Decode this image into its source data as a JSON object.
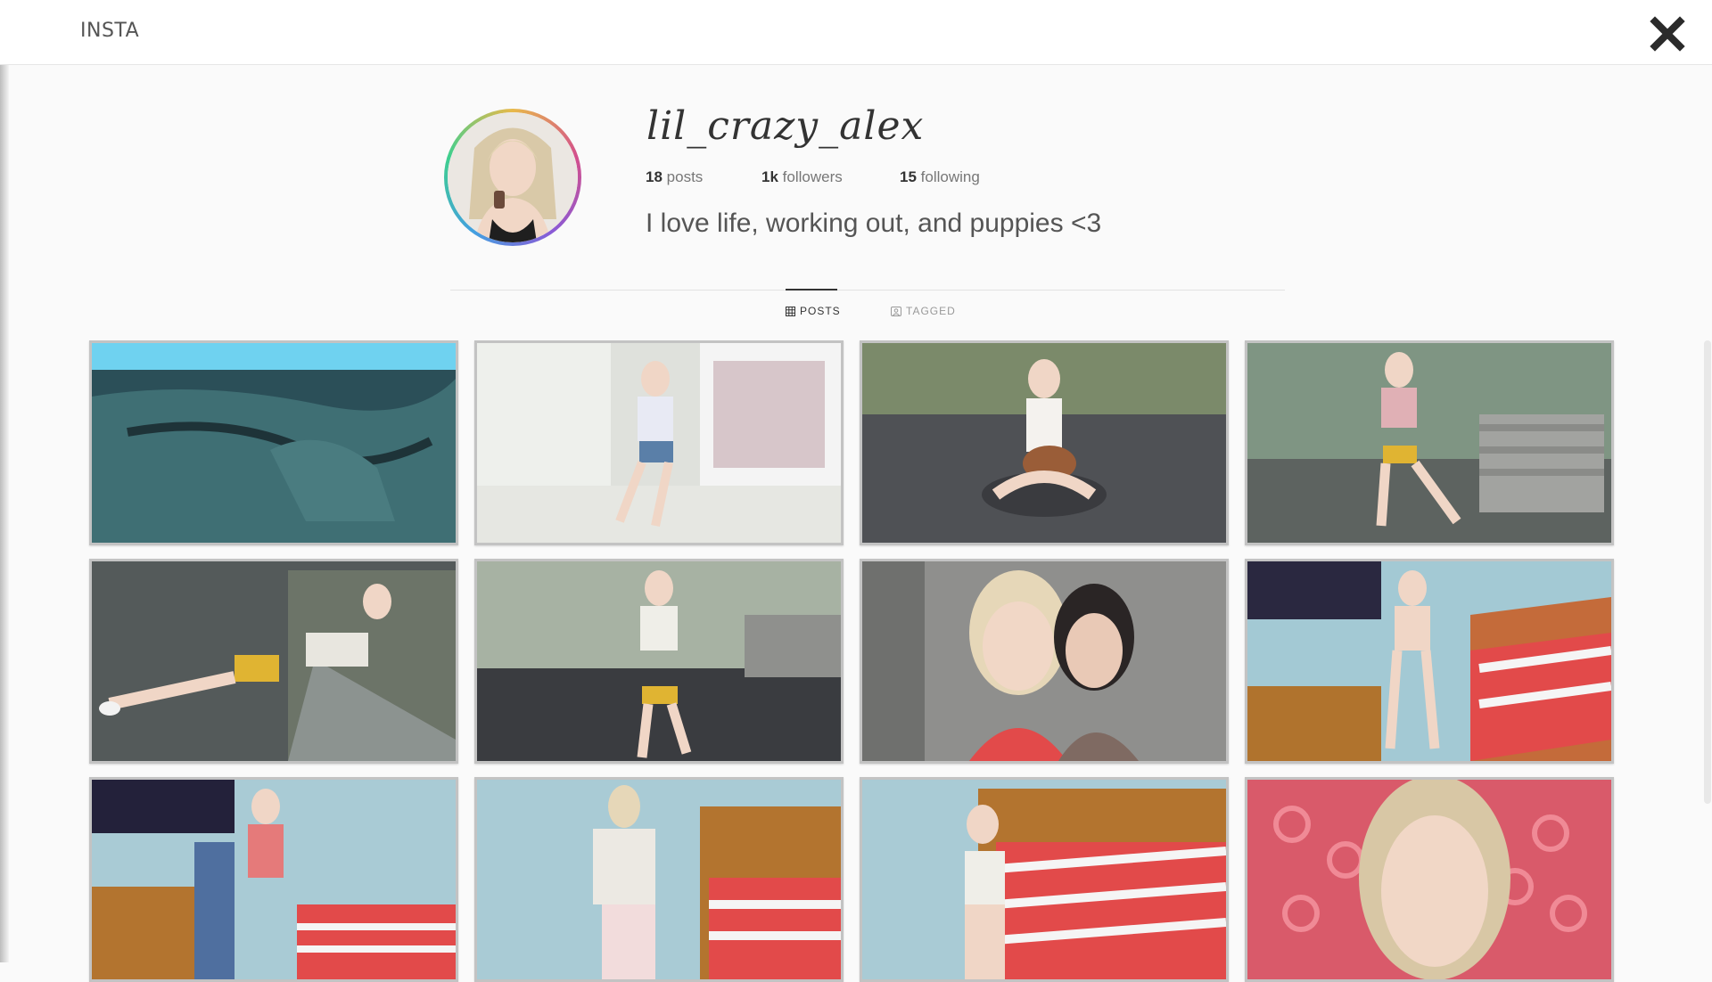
{
  "app": {
    "title": "INSTA",
    "close_icon": "close-icon"
  },
  "profile": {
    "username": "lil_crazy_alex",
    "posts_count": "18",
    "posts_label": "posts",
    "followers_count": "1k",
    "followers_label": "followers",
    "following_count": "15",
    "following_label": "following",
    "bio": "I love life, working out, and puppies <3"
  },
  "tabs": [
    {
      "label": "POSTS",
      "icon": "grid-icon",
      "active": true
    },
    {
      "label": "TAGGED",
      "icon": "tag-icon",
      "active": false
    }
  ],
  "posts": [
    {
      "scene": "tanning-bed"
    },
    {
      "scene": "cafe-window"
    },
    {
      "scene": "park-with-puppy"
    },
    {
      "scene": "park-bench-pose"
    },
    {
      "scene": "bench-pushup"
    },
    {
      "scene": "park-walk"
    },
    {
      "scene": "selfie-with-friend"
    },
    {
      "scene": "bedroom-selfie"
    },
    {
      "scene": "bedroom-towel"
    },
    {
      "scene": "bedroom-phone"
    },
    {
      "scene": "bed-mirror-selfie"
    },
    {
      "scene": "pillow-closeup"
    }
  ],
  "colors": {
    "accent": "#333333",
    "background": "#fafafa",
    "tile_border": "#c3c3c3"
  }
}
